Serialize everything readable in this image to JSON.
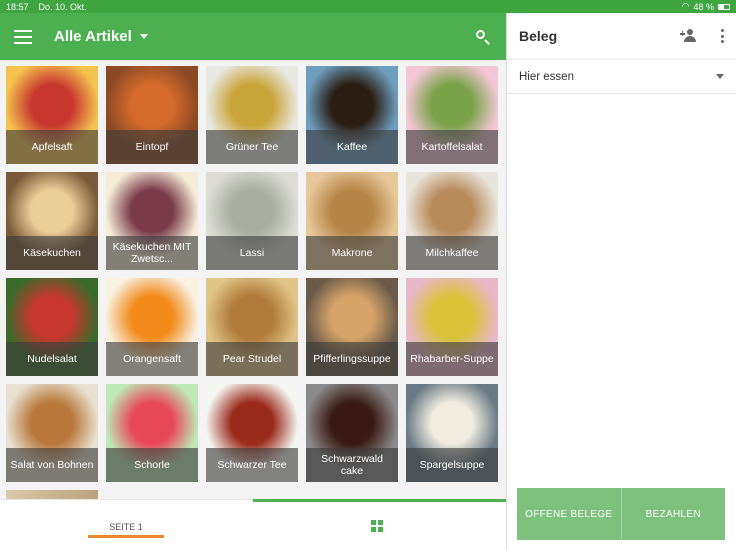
{
  "status": {
    "time": "18:57",
    "date": "Do. 10. Okt.",
    "battery": "48 %"
  },
  "appbar": {
    "title": "Alle Artikel"
  },
  "products": [
    {
      "label": "Apfelsaft",
      "colors": [
        "#f4c24e",
        "#c8382f"
      ]
    },
    {
      "label": "Eintopf",
      "colors": [
        "#8b4a24",
        "#d66a2c"
      ]
    },
    {
      "label": "Grüner Tee",
      "colors": [
        "#e8e8e2",
        "#c9a438"
      ]
    },
    {
      "label": "Kaffee",
      "colors": [
        "#6e9fbf",
        "#2b1d12"
      ]
    },
    {
      "label": "Kartoffelsalat",
      "colors": [
        "#f2c6d4",
        "#7aa34a"
      ]
    },
    {
      "label": "Käsekuchen",
      "colors": [
        "#7a5a38",
        "#e9cf98"
      ]
    },
    {
      "label": "Käsekuchen MIT Zwetsc...",
      "colors": [
        "#f4ecd8",
        "#7a3a4a"
      ]
    },
    {
      "label": "Lassi",
      "colors": [
        "#dcdcd4",
        "#a8aea0"
      ]
    },
    {
      "label": "Makrone",
      "colors": [
        "#e7c79a",
        "#b78548"
      ]
    },
    {
      "label": "Milchkaffee",
      "colors": [
        "#e8e4dc",
        "#b88a5a"
      ]
    },
    {
      "label": "Nudelsalat",
      "colors": [
        "#3a6a2a",
        "#c8382f"
      ]
    },
    {
      "label": "Orangensaft",
      "colors": [
        "#f8f0e0",
        "#f28a1a"
      ]
    },
    {
      "label": "Pear Strudel",
      "colors": [
        "#e0c488",
        "#b07a3a"
      ]
    },
    {
      "label": "Pfifferlingssuppe",
      "colors": [
        "#6a5a4a",
        "#d6a468"
      ]
    },
    {
      "label": "Rhabarber-Suppe",
      "colors": [
        "#e8b8c8",
        "#d8c238"
      ]
    },
    {
      "label": "Salat von Bohnen",
      "colors": [
        "#e8e0d0",
        "#b8783a"
      ]
    },
    {
      "label": "Schorle",
      "colors": [
        "#bfe8b8",
        "#e8485a"
      ]
    },
    {
      "label": "Schwarzer Tee",
      "colors": [
        "#f4f4f0",
        "#9a2a1a"
      ]
    },
    {
      "label": "Schwarzwald cake",
      "colors": [
        "#8a8a8a",
        "#3a1a14"
      ]
    },
    {
      "label": "Spargelsuppe",
      "colors": [
        "#6a7a84",
        "#f0ece0"
      ]
    }
  ],
  "bottom": {
    "page_label": "SEITE 1"
  },
  "receipt": {
    "title": "Beleg",
    "dining_option": "Hier essen",
    "open_receipts_label": "OFFENE BELEGE",
    "pay_label": "BEZAHLEN"
  },
  "theme": {
    "primary": "#4cb050",
    "status": "#3ea541",
    "accent": "#e8892e",
    "button": "#7cc27c"
  }
}
